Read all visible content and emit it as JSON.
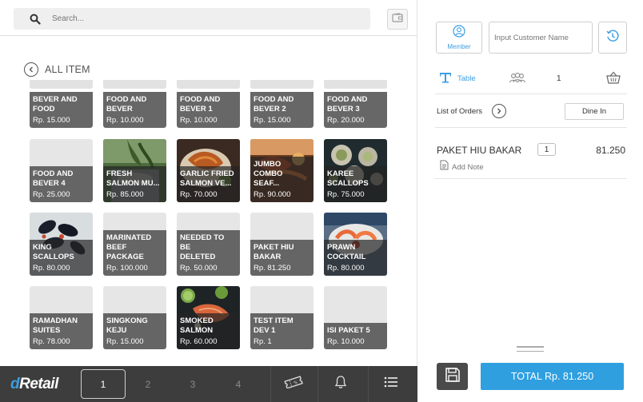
{
  "search": {
    "placeholder": "Search..."
  },
  "catalog": {
    "section_label": "ALL ITEM",
    "items": [
      {
        "name": "BEVER AND\nFOOD",
        "price": "Rp. 15.000",
        "photo": "none"
      },
      {
        "name": "FOOD AND\nBEVER",
        "price": "Rp. 10.000",
        "photo": "none"
      },
      {
        "name": "FOOD AND\nBEVER 1",
        "price": "Rp. 10.000",
        "photo": "none"
      },
      {
        "name": "FOOD AND\nBEVER 2",
        "price": "Rp. 15.000",
        "photo": "none"
      },
      {
        "name": "FOOD AND\nBEVER 3",
        "price": "Rp. 20.000",
        "photo": "none"
      },
      {
        "name": "FOOD AND\nBEVER 4",
        "price": "Rp. 25.000",
        "photo": "none"
      },
      {
        "name": "FRESH\nSALMON MU...",
        "price": "Rp. 85.000",
        "photo": "salmon-plant"
      },
      {
        "name": "GARLIC FRIED\nSALMON VE...",
        "price": "Rp. 70.000",
        "photo": "fried-salmon"
      },
      {
        "name": "JUMBO\nCOMBO SEAF...",
        "price": "Rp. 90.000",
        "photo": "seafood-platter"
      },
      {
        "name": "KAREE\nSCALLOPS",
        "price": "Rp. 75.000",
        "photo": "scallops-dark"
      },
      {
        "name": "KING\nSCALLOPS",
        "price": "Rp. 80.000",
        "photo": "mussels"
      },
      {
        "name": "MARINATED\nBEEF PACKAGE",
        "price": "Rp. 100.000",
        "photo": "none"
      },
      {
        "name": "NEEDED TO BE\nDELETED",
        "price": "Rp. 50.000",
        "photo": "none"
      },
      {
        "name": "PAKET HIU\nBAKAR",
        "price": "Rp. 81.250",
        "photo": "none"
      },
      {
        "name": "PRAWN\nCOCKTAIL",
        "price": "Rp. 80.000",
        "photo": "prawn-cocktail"
      },
      {
        "name": "RAMADHAN\nSUITES",
        "price": "Rp. 78.000",
        "photo": "none"
      },
      {
        "name": "SINGKONG\nKEJU",
        "price": "Rp. 15.000",
        "photo": "none"
      },
      {
        "name": "SMOKED\nSALMON",
        "price": "Rp. 60.000",
        "photo": "smoked-salmon"
      },
      {
        "name": "TEST ITEM\nDEV 1",
        "price": "Rp. 1",
        "photo": "none"
      },
      {
        "name": "ISI PAKET 5",
        "price": "Rp. 10.000",
        "photo": "none"
      }
    ]
  },
  "bottom_nav": {
    "logo_first": "d",
    "logo_rest": "Retail",
    "pages": [
      "1",
      "2",
      "3",
      "4"
    ],
    "active_page": "1",
    "icons": [
      "ticket-icon",
      "bell-icon",
      "menu-list-icon"
    ]
  },
  "order_panel": {
    "member_label": "Member",
    "customer_placeholder": "Input Customer Name",
    "table_label": "Table",
    "guest_count": "1",
    "orders_label": "List of Orders",
    "dine_mode": "Dine In",
    "items": [
      {
        "name": "PAKET HIU BAKAR",
        "qty": "1",
        "price": "81.250",
        "note_label": "Add Note"
      }
    ],
    "total_label": "TOTAL Rp. 81.250"
  },
  "colors": {
    "accent": "#2f9fe0",
    "nav_bg": "#3d3d3d",
    "tile_label": "#5a5a5a"
  }
}
